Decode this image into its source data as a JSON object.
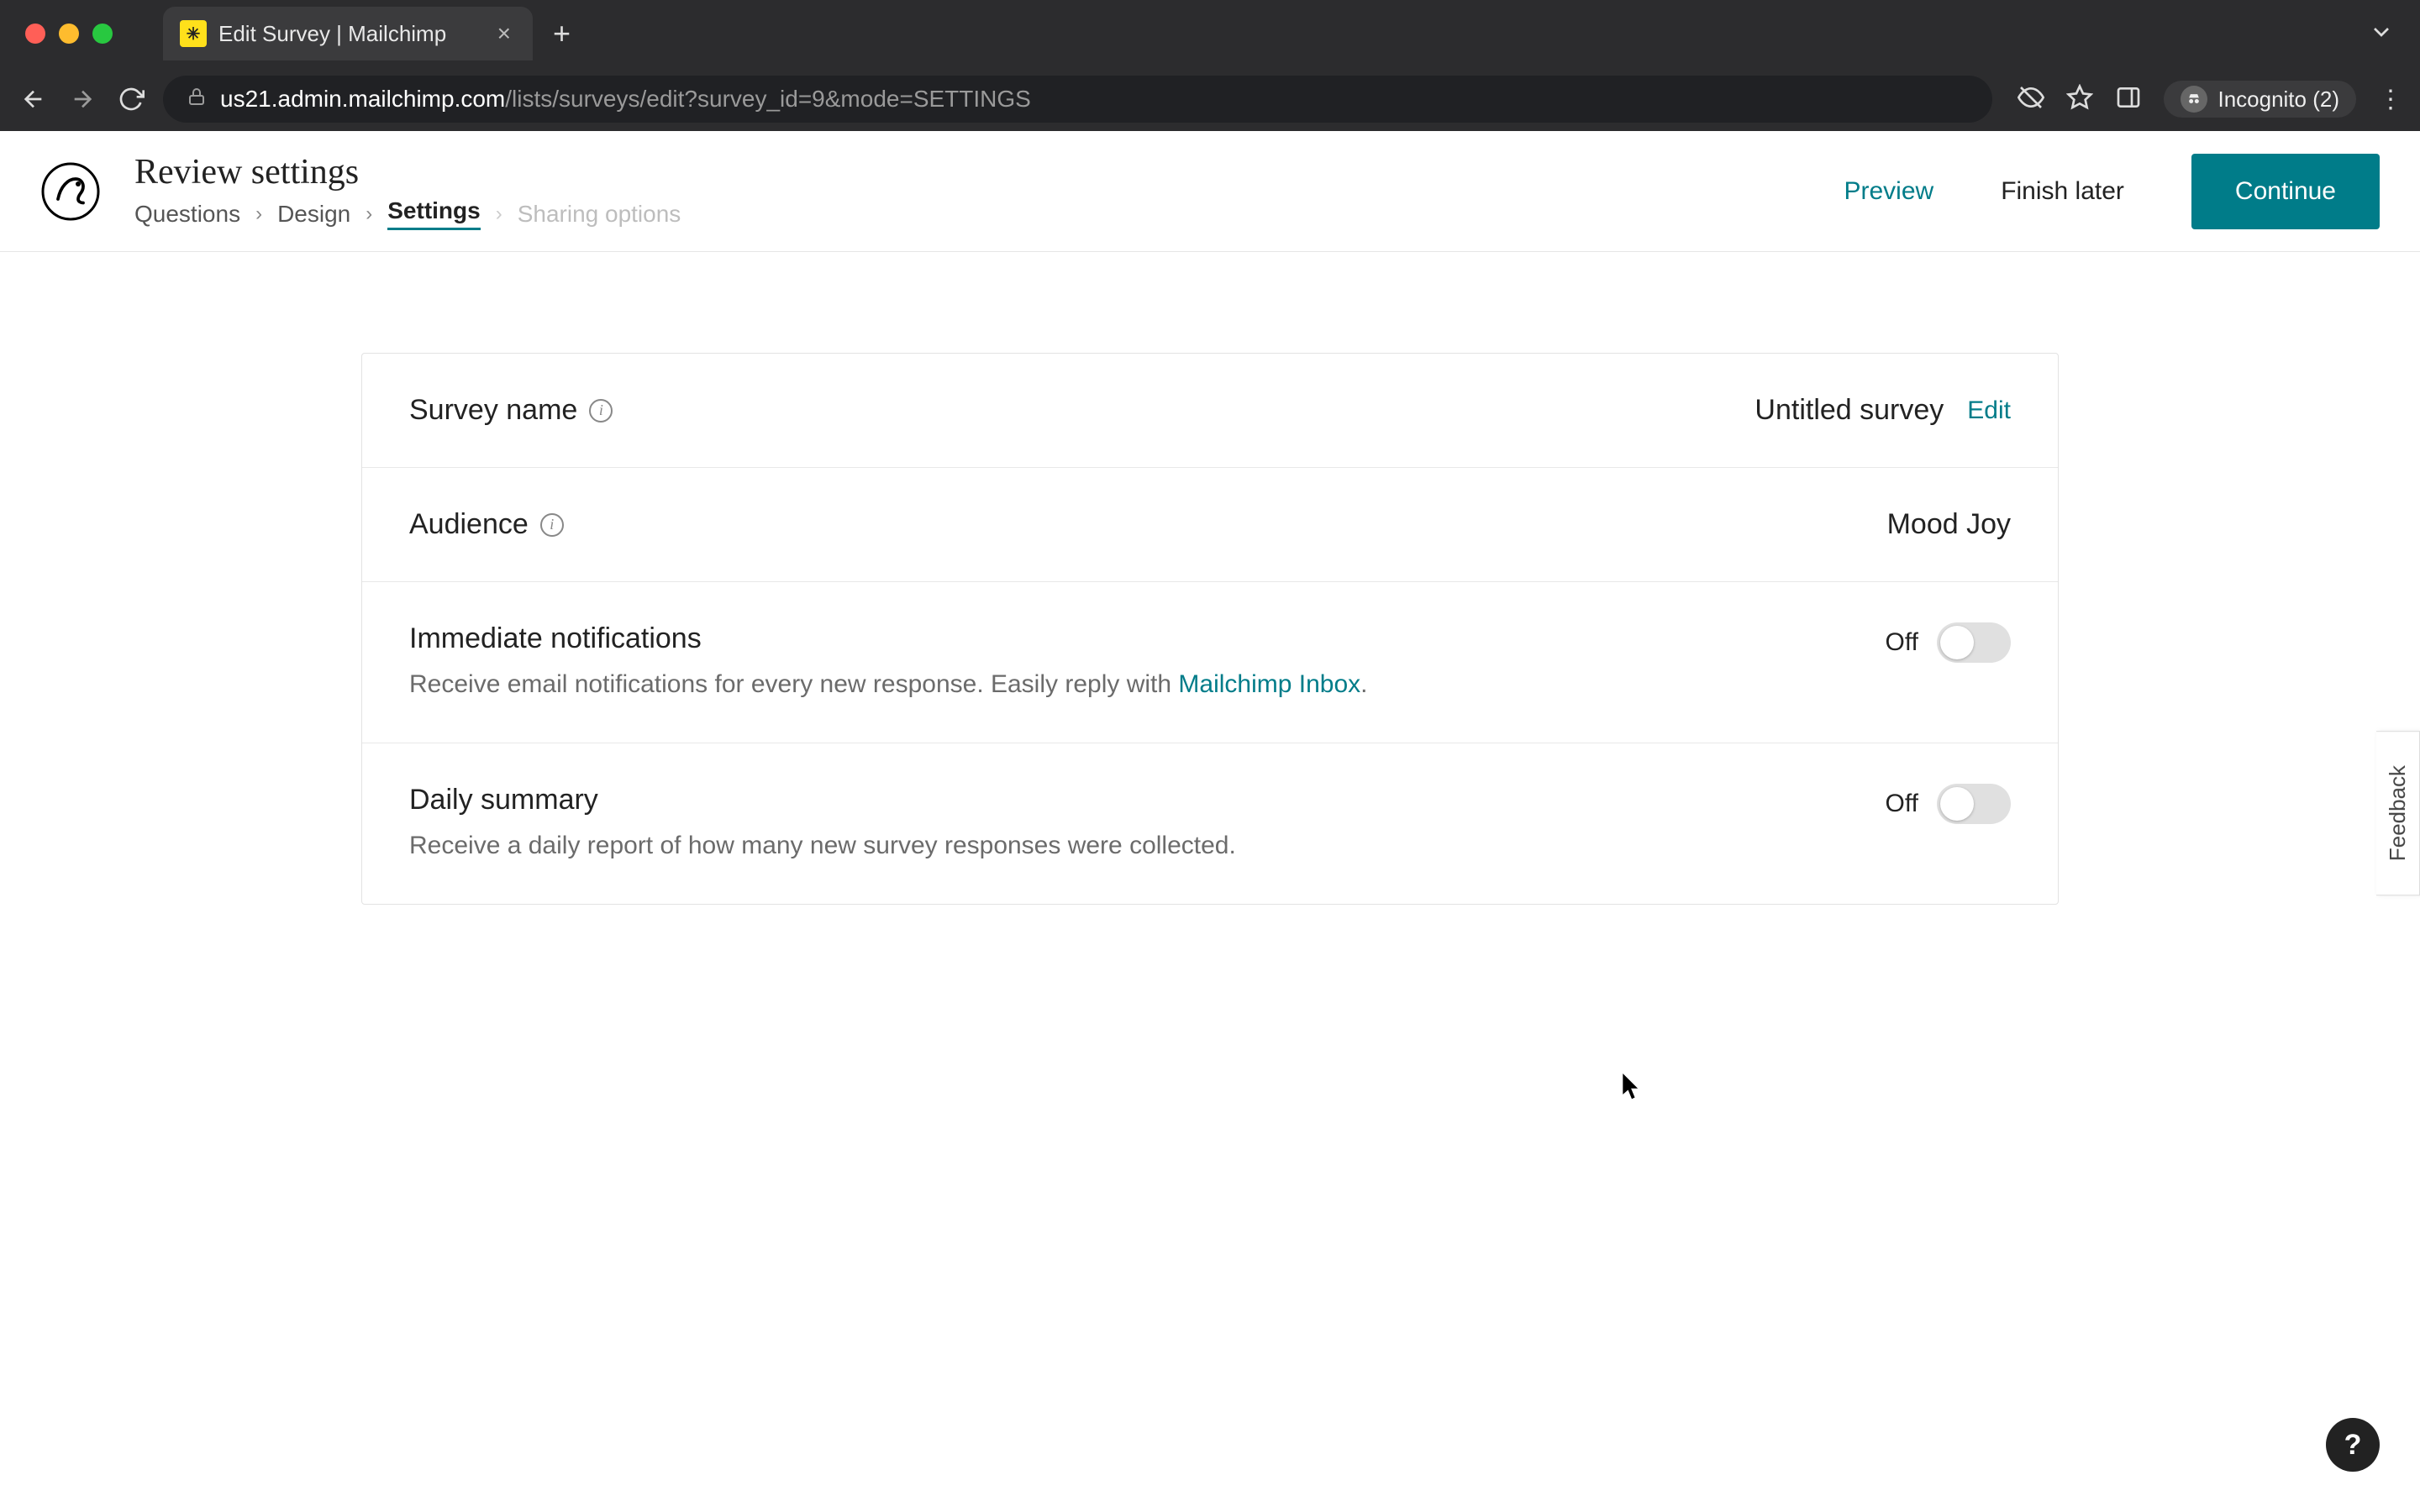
{
  "browser": {
    "tab_title": "Edit Survey | Mailchimp",
    "url_domain": "us21.admin.mailchimp.com",
    "url_path": "/lists/surveys/edit?survey_id=9&mode=SETTINGS",
    "incognito_label": "Incognito (2)"
  },
  "header": {
    "page_title": "Review settings",
    "breadcrumb": {
      "questions": "Questions",
      "design": "Design",
      "settings": "Settings",
      "sharing": "Sharing options"
    },
    "actions": {
      "preview": "Preview",
      "finish_later": "Finish later",
      "continue": "Continue"
    }
  },
  "settings": {
    "survey_name": {
      "label": "Survey name",
      "value": "Untitled survey",
      "edit": "Edit"
    },
    "audience": {
      "label": "Audience",
      "value": "Mood Joy"
    },
    "immediate_notifications": {
      "label": "Immediate notifications",
      "desc_prefix": "Receive email notifications for every new response. Easily reply with ",
      "desc_link": "Mailchimp Inbox",
      "desc_suffix": ".",
      "state": "Off"
    },
    "daily_summary": {
      "label": "Daily summary",
      "desc": "Receive a daily report of how many new survey responses were collected.",
      "state": "Off"
    }
  },
  "floating": {
    "feedback": "Feedback",
    "help": "?"
  }
}
